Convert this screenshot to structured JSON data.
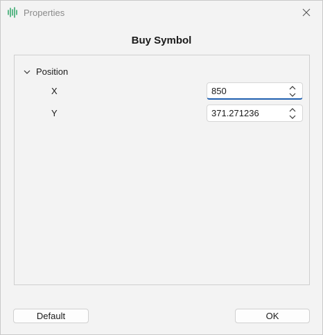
{
  "window": {
    "title": "Properties",
    "heading": "Buy Symbol"
  },
  "icons": {
    "app": "audio-waveform-icon",
    "close": "close-icon",
    "expand": "chevron-down-icon",
    "spin_up": "chevron-up-icon",
    "spin_down": "chevron-down-icon"
  },
  "colors": {
    "app_icon": "#1e9e5c",
    "focus_underline": "#1f5fb0",
    "title_text": "#8a8a8a"
  },
  "properties": {
    "group_label": "Position",
    "x_label": "X",
    "x_value": "850",
    "y_label": "Y",
    "y_value": "371.271236"
  },
  "buttons": {
    "default_label": "Default",
    "ok_label": "OK"
  }
}
